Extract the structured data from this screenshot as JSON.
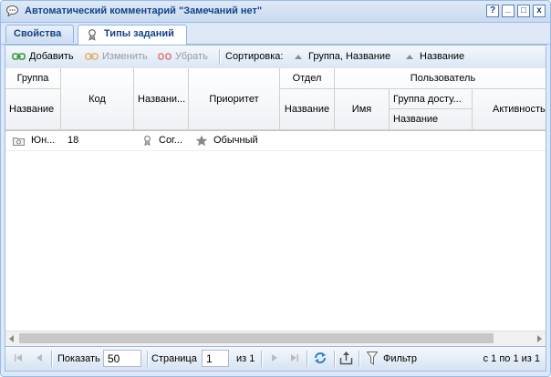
{
  "window": {
    "title": "Автоматический комментарий \"Замечаний нет\"",
    "tools": [
      "?",
      "_",
      "□",
      "x"
    ]
  },
  "tabs": [
    {
      "label": "Свойства",
      "active": false
    },
    {
      "label": "Типы заданий",
      "active": true
    }
  ],
  "toolbar": {
    "add_label": "Добавить",
    "edit_label": "Изменить",
    "remove_label": "Убрать",
    "sort_label": "Сортировка:",
    "sort_items": [
      "Группа, Название",
      "Название"
    ]
  },
  "grid": {
    "headers": {
      "group": "Группа",
      "group_name": "Название",
      "code": "Код",
      "name": "Названи...",
      "priority": "Приоритет",
      "dept": "Отдел",
      "dept_name": "Название",
      "user": "Пользователь",
      "user_name": "Имя",
      "access_group": "Группа досту...",
      "access_name": "Название",
      "activity": "Активность"
    },
    "rows": [
      {
        "group": "Юн...",
        "code": "18",
        "name": "Сог...",
        "priority": "Обычный"
      }
    ]
  },
  "pager": {
    "show_label": "Показать",
    "page_size": "50",
    "page_label": "Страница",
    "page": "1",
    "of_label": "из 1",
    "filter_label": "Фильтр",
    "summary": "с 1 по 1 из 1"
  },
  "colors": {
    "accent": "#15428b",
    "border": "#99bbe8"
  }
}
